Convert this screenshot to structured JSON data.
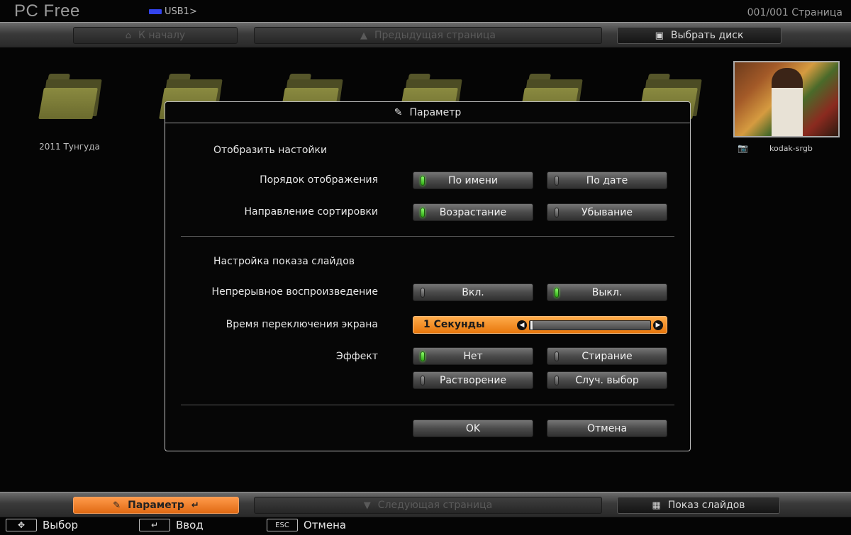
{
  "app": {
    "title": "PC Free",
    "path": "USB1>",
    "page_counter": "001/001 Страница"
  },
  "top_bar": {
    "home": "К началу",
    "prev_page": "Предыдущая страница",
    "select_disk": "Выбрать диск"
  },
  "files": {
    "folder_label": "2011 Тунгуда",
    "thumb_label": "kodak-srgb"
  },
  "dialog": {
    "title": "Параметр",
    "display_section": "Отобразить настойки",
    "order_label": "Порядок отображения",
    "order_options": [
      "По имени",
      "По дате"
    ],
    "order_selected": "По имени",
    "sort_label": "Направление сортировки",
    "sort_options": [
      "Возрастание",
      "Убывание"
    ],
    "sort_selected": "Возрастание",
    "slideshow_section": "Настройка показа слайдов",
    "continuous_label": "Непрерывное воспроизведение",
    "continuous_options": [
      "Вкл.",
      "Выкл."
    ],
    "continuous_selected": "Выкл.",
    "switch_label": "Время переключения экрана",
    "switch_value": "1 Секунды",
    "switch_level": 0.0,
    "effect_label": "Эффект",
    "effect_options": [
      "Нет",
      "Стирание",
      "Растворение",
      "Случ. выбор"
    ],
    "effect_selected": "Нет",
    "ok": "OK",
    "cancel": "Отмена"
  },
  "bottom_bar": {
    "param": "Параметр",
    "next_page": "Следующая страница",
    "slideshow": "Показ слайдов"
  },
  "help": {
    "select": "Выбор",
    "enter": "Ввод",
    "esc_key": "ESC",
    "cancel": "Отмена"
  },
  "colors": {
    "accent_orange": "#f08a2a",
    "led_on": "#5eff3a"
  }
}
